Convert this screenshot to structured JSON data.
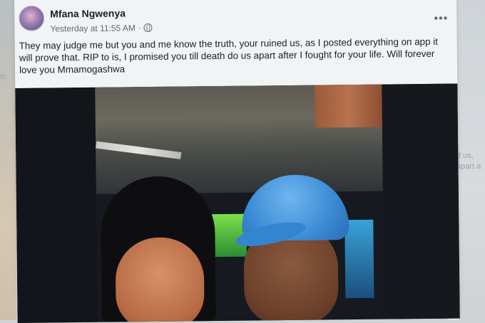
{
  "post": {
    "author_name": "Mfana Ngwenya",
    "timestamp": "Yesterday at 11:55 AM",
    "separator": "·",
    "caption": "They may judge me but you and me know the truth, your ruined us, as I posted everything on app it will prove that. RIP to is, I promised you till death do us apart after I fought for your life. Will forever love you Mmamogashwa",
    "more_label": "•••",
    "audience_icon": "globe-icon"
  },
  "background": {
    "left_fragment": "th",
    "right_fragment_1": "d us,",
    "right_fragment_2": "apart a"
  }
}
